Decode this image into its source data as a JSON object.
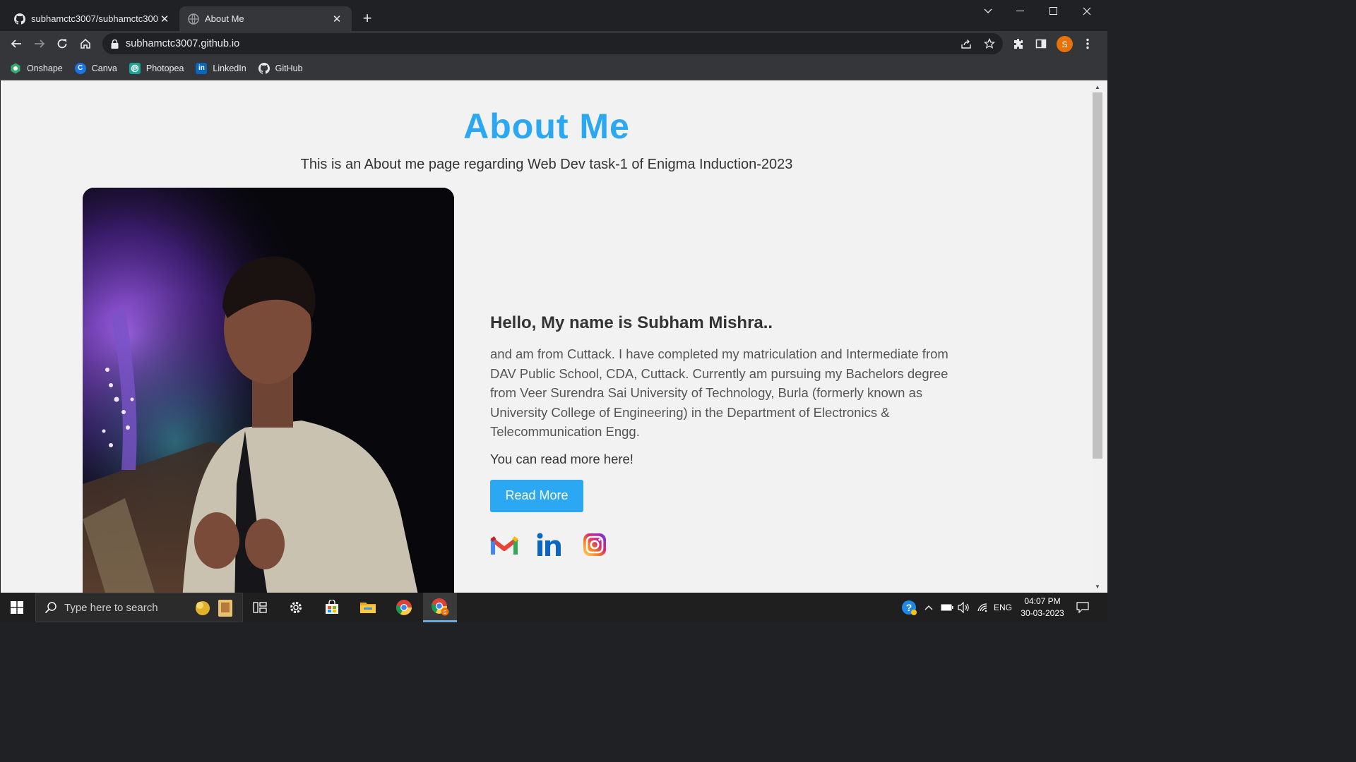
{
  "browser": {
    "tabs": [
      {
        "label": "subhamctc3007/subhamctc3007",
        "icon": "github-icon",
        "active": false
      },
      {
        "label": "About Me",
        "icon": "globe-icon",
        "active": true
      }
    ],
    "url": "subhamctc3007.github.io",
    "profile_initial": "S",
    "bookmarks": [
      {
        "label": "Onshape",
        "icon": "onshape-icon",
        "color": "#3aa96d"
      },
      {
        "label": "Canva",
        "icon": "canva-icon",
        "color": "#1a73e8"
      },
      {
        "label": "Photopea",
        "icon": "photopea-icon",
        "color": "#18a497"
      },
      {
        "label": "LinkedIn",
        "icon": "linkedin-icon",
        "color": "#0a66c2"
      },
      {
        "label": "GitHub",
        "icon": "github-icon",
        "color": "#ffffff"
      }
    ]
  },
  "page": {
    "heading": "About Me",
    "subheading": "This is an About me page regarding Web Dev task-1 of Enigma Induction-2023",
    "greeting": "Hello, My name is Subham Mishra..",
    "bio": "and am from Cuttack. I have completed my matriculation and Intermediate from DAV Public School, CDA, Cuttack. Currently am pursuing my Bachelors degree from Veer Surendra Sai University of Technology, Burla (formerly known as University College of Engineering) in the Department of Electronics & Telecommunication Engg.",
    "read_more_text": "You can read more here!",
    "read_more_button": "Read More",
    "accent_color": "#2ba8f1",
    "socials": [
      "gmail-icon",
      "linkedin-icon",
      "instagram-icon"
    ]
  },
  "taskbar": {
    "search_placeholder": "Type here to search",
    "language": "ENG",
    "time": "04:07 PM",
    "date": "30-03-2023"
  }
}
